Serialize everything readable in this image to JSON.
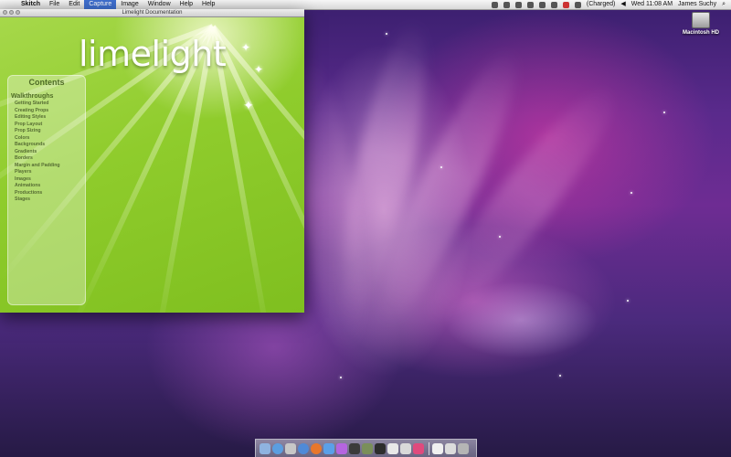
{
  "menubar": {
    "app_name": "Skitch",
    "menus": [
      "File",
      "Edit",
      "Capture",
      "Image",
      "Window",
      "Help",
      "Help"
    ],
    "battery_status": "(Charged)",
    "clock": "Wed 11:08 AM",
    "user": "James Suchy"
  },
  "desktop": {
    "drive_label": "Macintosh HD"
  },
  "window": {
    "title": "Limelight Documentation",
    "logo_text": "limelight",
    "contents_title": "Contents",
    "section_title": "Walkthroughs",
    "nav_items": [
      "Getting Started",
      "Creating Props",
      "Editing Styles",
      "Prop Layout",
      "Prop Sizing",
      "Colors",
      "Backgrounds",
      "Gradients",
      "Borders",
      "Margin and Padding",
      "Players",
      "Images",
      "Animations",
      "Productions",
      "Stages"
    ]
  },
  "dock": {
    "icons": [
      "finder-icon",
      "mail-icon",
      "preview-icon",
      "safari-icon",
      "firefox-icon",
      "ichat-icon",
      "itunes-icon",
      "terminal-icon",
      "photo-icon",
      "terminal2-icon",
      "textedit-icon",
      "skitch-icon",
      "heart-icon",
      "documents-icon",
      "downloads-icon",
      "trash-icon"
    ],
    "colors": [
      "#8fb3e0",
      "#5b9ee0",
      "#c7c7c7",
      "#4f8ad8",
      "#e8772b",
      "#5aa0e8",
      "#b565e0",
      "#3b3b3b",
      "#7a8f5a",
      "#2d2d2d",
      "#e8e8e8",
      "#d9d9d9",
      "#e04a7d",
      "#f0f0f0",
      "#dcdcdc",
      "#b5b5b5"
    ]
  }
}
